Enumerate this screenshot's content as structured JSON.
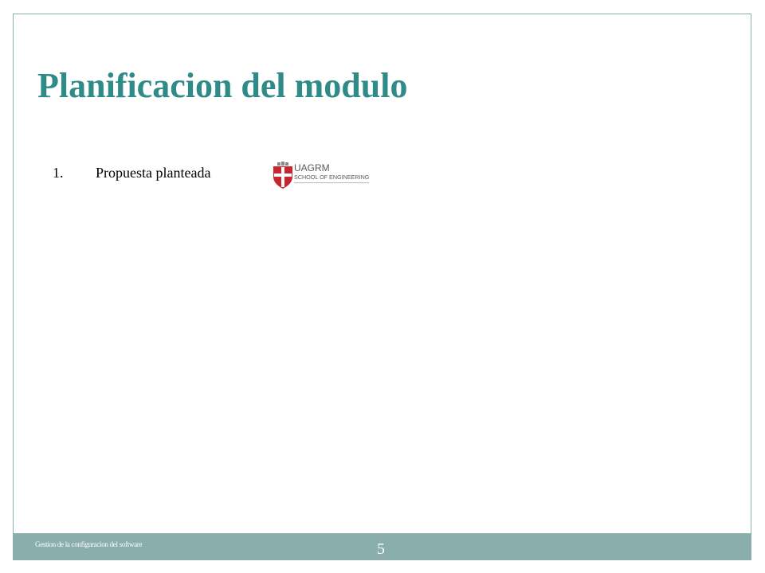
{
  "slide": {
    "title": "Planificacion del modulo",
    "list_items": [
      {
        "number": "1.",
        "text": "Propuesta planteada"
      }
    ],
    "logo": {
      "line1": "UAGRM",
      "line2": "SCHOOL OF ENGINEERING",
      "icon": "shield-icon"
    },
    "footer_text": "Gestion de la configuracion del software",
    "page_number": "5"
  },
  "colors": {
    "title": "#2e8b87",
    "footer_bar": "#8aaeac",
    "frame_border": "#8eaeac",
    "logo_red": "#c8262f"
  }
}
